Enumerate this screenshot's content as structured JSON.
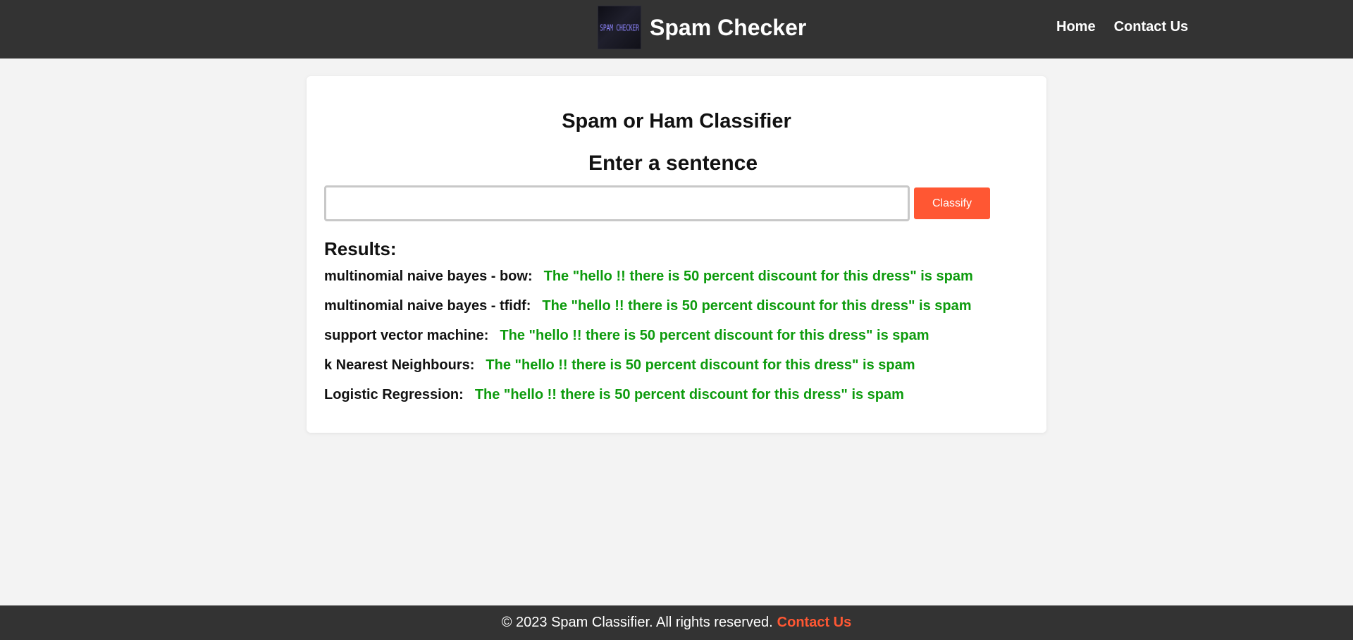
{
  "header": {
    "logo_text": "SPAM CHECKER",
    "title": "Spam Checker",
    "nav": [
      {
        "label": "Home"
      },
      {
        "label": "Contact Us"
      }
    ]
  },
  "main": {
    "title": "Spam or Ham Classifier",
    "prompt": "Enter a sentence",
    "input": {
      "value": "",
      "placeholder": ""
    },
    "classify_label": "Classify",
    "results_heading": "Results:",
    "results": [
      {
        "model": "multinomial naive bayes - bow:",
        "verdict": "The \"hello !! there is 50 percent discount for this dress\" is spam"
      },
      {
        "model": "multinomial naive bayes - tfidf:",
        "verdict": "The \"hello !! there is 50 percent discount for this dress\" is spam"
      },
      {
        "model": "support vector machine:",
        "verdict": "The \"hello !! there is 50 percent discount for this dress\" is spam"
      },
      {
        "model": "k Nearest Neighbours:",
        "verdict": "The \"hello !! there is 50 percent discount for this dress\" is spam"
      },
      {
        "model": "Logistic Regression:",
        "verdict": "The \"hello !! there is 50 percent discount for this dress\" is spam"
      }
    ]
  },
  "footer": {
    "text": "© 2023 Spam Classifier. All rights reserved.",
    "link_label": "Contact Us"
  },
  "colors": {
    "header_bg": "#333333",
    "accent": "#ff5733",
    "spam_text": "#0d9b0d",
    "page_bg": "#f3f3f3"
  }
}
